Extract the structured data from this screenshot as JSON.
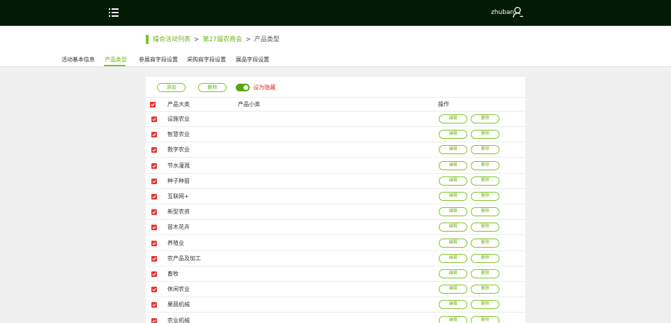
{
  "topbar": {
    "username": "zhuban"
  },
  "breadcrumb": {
    "items": [
      "撮合活动列表",
      "第27届农商会"
    ],
    "separator": ">",
    "current": "产品类型"
  },
  "tabs": [
    {
      "label": "活动基本信息",
      "active": false
    },
    {
      "label": "产品类型",
      "active": true
    },
    {
      "label": "参展商字段设置",
      "active": false
    },
    {
      "label": "采购商字段设置",
      "active": false
    },
    {
      "label": "展品字段设置",
      "active": false
    }
  ],
  "toolbar": {
    "add_label": "添加",
    "delete_label": "删除",
    "toggle_on": true,
    "toggle_label": "设为隐藏"
  },
  "table": {
    "columns": {
      "category": "产品大类",
      "subcategory": "产品小类",
      "actions": "操作"
    },
    "edit_label": "编辑",
    "delete_label": "删除",
    "rows": [
      {
        "category": "设施农业",
        "checked": true
      },
      {
        "category": "智慧农业",
        "checked": true
      },
      {
        "category": "数字农业",
        "checked": true
      },
      {
        "category": "节水灌溉",
        "checked": true
      },
      {
        "category": "种子种苗",
        "checked": true
      },
      {
        "category": "互联网+",
        "checked": true
      },
      {
        "category": "新型农资",
        "checked": true
      },
      {
        "category": "苗木花卉",
        "checked": true
      },
      {
        "category": "养殖业",
        "checked": true
      },
      {
        "category": "农产品及加工",
        "checked": true
      },
      {
        "category": "畜牧",
        "checked": true
      },
      {
        "category": "休闲农业",
        "checked": true
      },
      {
        "category": "果蔬机械",
        "checked": true
      },
      {
        "category": "农业机械",
        "checked": true
      }
    ]
  },
  "colors": {
    "topbar": "#031a03",
    "accent": "#7dc421",
    "accent_text": "#6cb51a",
    "checkbox": "#e23636",
    "toggle_label": "#e02b2b"
  },
  "icons": {
    "menu": "menu-list-icon",
    "user": "user-icon",
    "check": "check-icon"
  }
}
